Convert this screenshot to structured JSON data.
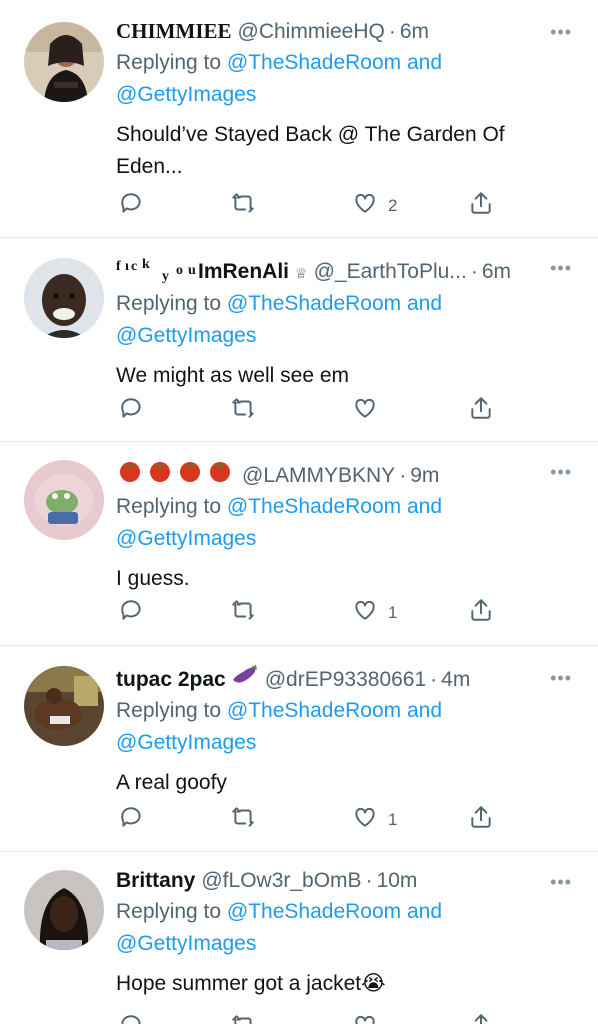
{
  "feed": {
    "tweets": [
      {
        "name": "CHIMMIEE",
        "handle": "@ChimmieeHQ",
        "sep": "·",
        "time": "6m",
        "replying_prefix": "Replying to",
        "mention1": "@TheShadeRoom",
        "and": "and",
        "mention2": "@GettyImages",
        "text_line1": "Should’ve Stayed Back @ The Garden Of",
        "text_line2": "Eden...",
        "like_count": "2",
        "avatar_colors": {
          "bg": "#d8cbb8",
          "figure": "#2a1f1c",
          "skin": "#9a6a4f"
        }
      },
      {
        "name_prefix_1": "f",
        "name_prefix_2": "ı",
        "name_prefix_3": "c",
        "name_prefix_4": "k",
        "name_prefix_5": "y",
        "name_prefix_6": "o",
        "name_prefix_7": "u",
        "name": "ImRenAli",
        "crown": "♕",
        "handle": "@_EarthToPlu...",
        "sep": "·",
        "time": "6m",
        "replying_prefix": "Replying to",
        "mention1": "@TheShadeRoom",
        "and": "and",
        "mention2": "@GettyImages",
        "text": "We might as well see em",
        "like_count": "",
        "avatar_colors": {
          "bg": "#dfe4ea",
          "skin": "#3b2a22"
        }
      },
      {
        "handle": "@LAMMYBKNY",
        "sep": "·",
        "time": "9m",
        "replying_prefix": "Replying to",
        "mention1": "@TheShadeRoom",
        "and": "and",
        "mention2": "@GettyImages",
        "text": "I guess.",
        "like_count": "1",
        "avatar_colors": {
          "bg": "#e8c9cf",
          "frog": "#7fae6a"
        }
      },
      {
        "name": "tupac 2pac",
        "handle": "@drEP93380661",
        "sep": "·",
        "time": "4m",
        "replying_prefix": "Replying to",
        "mention1": "@TheShadeRoom",
        "and": "and",
        "mention2": "@GettyImages",
        "text": "A real goofy",
        "like_count": "1",
        "avatar_colors": {
          "bg": "#5a4630",
          "skin": "#5c3a22"
        }
      },
      {
        "name": "Brittany",
        "handle": "@fLOw3r_bOmB",
        "sep": "·",
        "time": "10m",
        "replying_prefix": "Replying to",
        "mention1": "@TheShadeRoom",
        "and": "and",
        "mention2": "@GettyImages",
        "text": "Hope summer got a jacket",
        "emoji": "😭",
        "avatar_colors": {
          "bg": "#c9c4c2",
          "skin": "#3a2418"
        }
      }
    ],
    "more_glyph": "•••"
  },
  "colors": {
    "link": "#1d9bf0",
    "muted": "#536471",
    "text": "#0f1419",
    "divider": "#e6ecf0"
  },
  "icons": [
    "reply-icon",
    "retweet-icon",
    "like-icon",
    "share-icon",
    "more-icon"
  ]
}
